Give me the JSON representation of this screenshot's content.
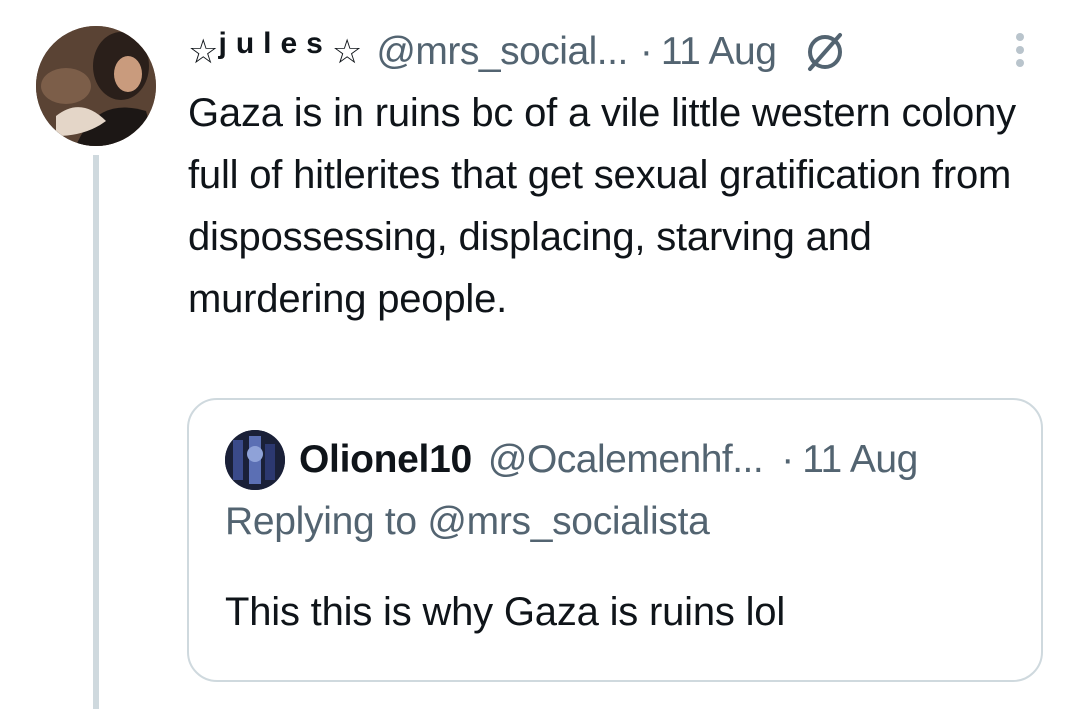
{
  "tweet": {
    "display_name": "jules",
    "star_left": "☆",
    "star_right": "☆",
    "handle": "@mrs_social...",
    "separator": "·",
    "date": "11 Aug",
    "text": "Gaza is in ruins bc of a vile little western colony full of hitlerites that get sexual gratification from dispossessing, displacing, starving and murdering people.",
    "icons": {
      "avatar": "profile-photo",
      "sensitive": "empty-set-icon",
      "more": "more-vertical-icon"
    }
  },
  "quote": {
    "display_name": "Olionel10",
    "handle": "@Ocalemenhf...",
    "separator": "·",
    "date": "11 Aug",
    "replying_to": "Replying to @mrs_socialista",
    "text": "This this is why Gaza is ruins lol"
  },
  "colors": {
    "primary_text": "#0f1419",
    "secondary_text": "#536471",
    "border": "#cfd9de",
    "background": "#ffffff"
  }
}
